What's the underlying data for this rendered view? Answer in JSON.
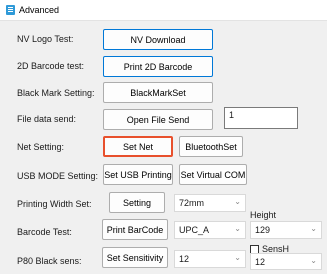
{
  "window": {
    "title": "Advanced"
  },
  "rows": {
    "nv_logo": {
      "label": "NV Logo Test:",
      "button": "NV Download"
    },
    "barcode2d": {
      "label": "2D Barcode test:",
      "button": "Print 2D Barcode"
    },
    "black_mark": {
      "label": "Black Mark Setting:",
      "button": "BlackMarkSet"
    },
    "file_send": {
      "label": "File data send:",
      "button": "Open File Send",
      "value": "1"
    },
    "net": {
      "label": "Net Setting:",
      "set_net": "Set Net",
      "bluetooth": "BluetoothSet"
    },
    "usb": {
      "label": "USB MODE Setting:",
      "set_usb": "Set USB Printing",
      "set_virtual": "Set Virtual COM"
    },
    "width": {
      "label": "Printing Width Set:",
      "button": "Setting",
      "selected": "72mm"
    },
    "barcode": {
      "label": "Barcode Test:",
      "button": "Print BarCode",
      "type_selected": "UPC_A",
      "height_label": "Height",
      "height_selected": "129"
    },
    "p80": {
      "label": "P80 Black sens:",
      "button": "Set Sensitivity",
      "sens_selected": "12",
      "sensh_label": "SensH",
      "sensh_selected": "12"
    }
  },
  "icons": {
    "app": "app-window-icon",
    "dropdown": "chevron-down-icon"
  },
  "colors": {
    "focus_border": "#0078d7",
    "highlight_border": "#e8502c",
    "app_icon": "#2f9ad8"
  }
}
